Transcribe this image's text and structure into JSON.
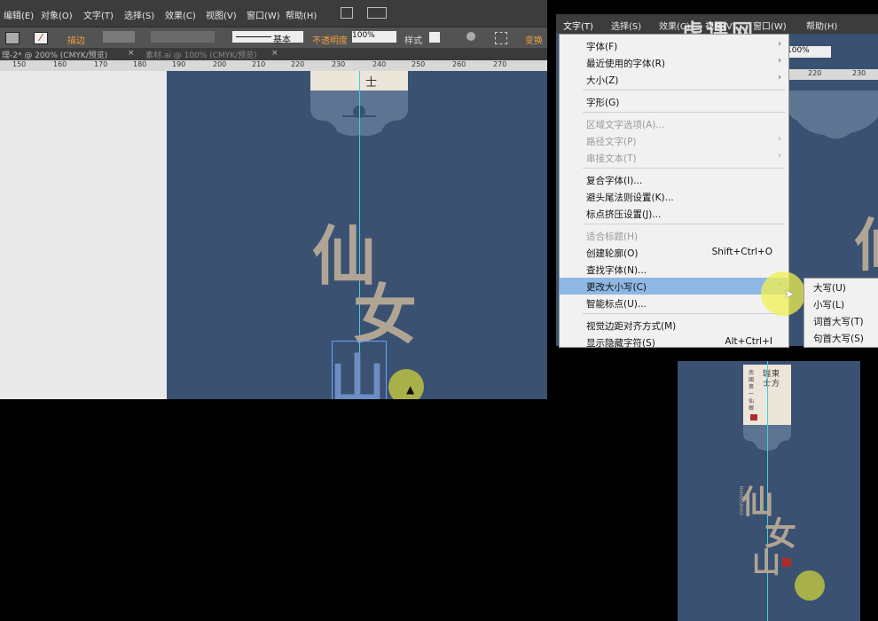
{
  "left_window": {
    "menu": [
      "编辑(E)",
      "对象(O)",
      "文字(T)",
      "选择(S)",
      "效果(C)",
      "视图(V)",
      "窗口(W)",
      "帮助(H)"
    ],
    "control": {
      "stroke_label": "描边",
      "stroke_style": "基本",
      "opacity_label": "不透明度",
      "opacity_value": "100%",
      "style_label": "样式",
      "transform_label": "变换"
    },
    "tabs": [
      "理-2* @ 200% (CMYK/预览)",
      "素材.ai @ 100% (CMYK/预览)"
    ],
    "ruler": [
      "150",
      "160",
      "170",
      "180",
      "190",
      "200",
      "210",
      "220",
      "230",
      "240",
      "250",
      "260",
      "270"
    ],
    "art": {
      "top_char": "士",
      "chars": [
        "仙",
        "女",
        "山"
      ]
    }
  },
  "right_window": {
    "menubar": [
      "文字(T)",
      "选择(S)",
      "效果(C)",
      "视图(V)",
      "窗口(W)",
      "帮助(H)"
    ],
    "zoom": "100%",
    "ruler": [
      "220",
      "230"
    ],
    "watermark": "虎课网"
  },
  "type_menu": {
    "items": [
      {
        "label": "字体(F)",
        "submenu": true
      },
      {
        "label": "最近使用的字体(R)",
        "submenu": true
      },
      {
        "label": "大小(Z)",
        "submenu": true
      },
      {
        "label": "字形(G)"
      },
      {
        "label": "区域文字选项(A)...",
        "disabled": true
      },
      {
        "label": "路径文字(P)",
        "disabled": true,
        "submenu": true
      },
      {
        "label": "串接文本(T)",
        "disabled": true,
        "submenu": true
      },
      {
        "label": "复合字体(I)..."
      },
      {
        "label": "避头尾法则设置(K)..."
      },
      {
        "label": "标点挤压设置(J)..."
      },
      {
        "label": "适合标题(H)",
        "disabled": true
      },
      {
        "label": "创建轮廓(O)",
        "shortcut": "Shift+Ctrl+O"
      },
      {
        "label": "查找字体(N)..."
      },
      {
        "label": "更改大小写(C)",
        "submenu": true,
        "highlighted": true
      },
      {
        "label": "智能标点(U)..."
      },
      {
        "label": "视觉边距对齐方式(M)"
      },
      {
        "label": "显示隐藏字符(S)",
        "shortcut": "Alt+Ctrl+I"
      }
    ],
    "submenu": [
      "大写(U)",
      "小写(L)",
      "词首大写(T)",
      "句首大写(S)"
    ]
  },
  "poster": {
    "title_lines": [
      "東方",
      "瑞士"
    ],
    "subtitle": "南國第一仙鄉",
    "chars": [
      "仙",
      "女",
      "山"
    ],
    "latin": "XIANNVSHAN"
  },
  "colors": {
    "navy": "#3a5171",
    "accent_green": "#a8b04a",
    "guide": "#3ed0e0",
    "highlight": "#8fb7e3",
    "seal_red": "#b02a2a"
  }
}
